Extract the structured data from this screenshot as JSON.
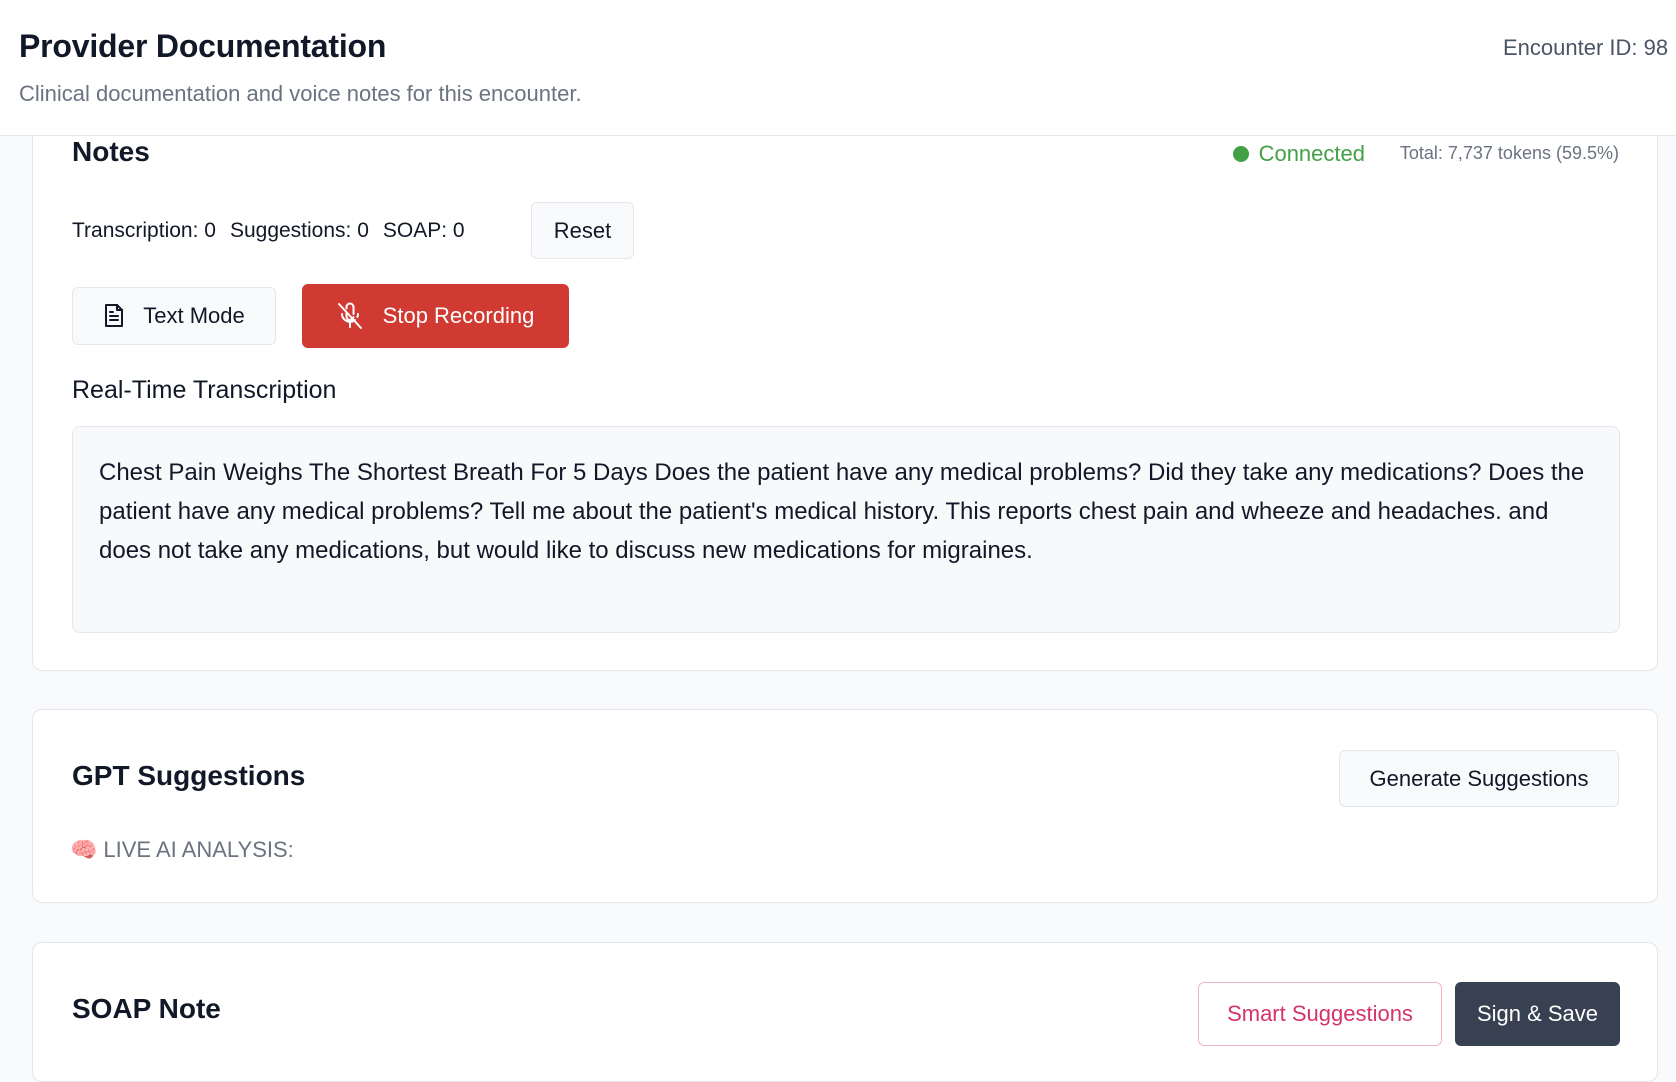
{
  "header": {
    "title": "Provider Documentation",
    "subtitle": "Clinical documentation and voice notes for this encounter.",
    "encounter_id": "Encounter ID: 98"
  },
  "notes": {
    "title": "Notes",
    "status": {
      "label": "Connected",
      "color": "#43a047"
    },
    "token_total": "Total: 7,737 tokens (59.5%)",
    "counts": {
      "transcription": "Transcription: 0",
      "suggestions": "Suggestions: 0",
      "soap": "SOAP: 0"
    },
    "reset_label": "Reset",
    "text_mode": {
      "label": "Text Mode",
      "icon": "document-icon"
    },
    "stop_recording": {
      "label": "Stop Recording",
      "icon": "mic-off-icon",
      "color": "#d13a33"
    },
    "transcription_heading": "Real-Time Transcription",
    "transcription_text": "Chest Pain Weighs The Shortest Breath For 5 Days Does the patient have any medical problems? Did they take any medications? Does the patient have any medical problems? Tell me about the patient's medical history. This reports chest pain and wheeze and headaches. and does not take any medications, but would like to discuss new medications for migraines."
  },
  "gpt": {
    "title": "GPT Suggestions",
    "generate_label": "Generate Suggestions",
    "analysis_icon": "🧠",
    "analysis_label": "LIVE AI ANALYSIS:"
  },
  "soap": {
    "title": "SOAP Note",
    "smart_suggestions_label": "Smart Suggestions",
    "sign_save_label": "Sign & Save",
    "accent_color": "#d6336c",
    "dark_color": "#374151"
  }
}
